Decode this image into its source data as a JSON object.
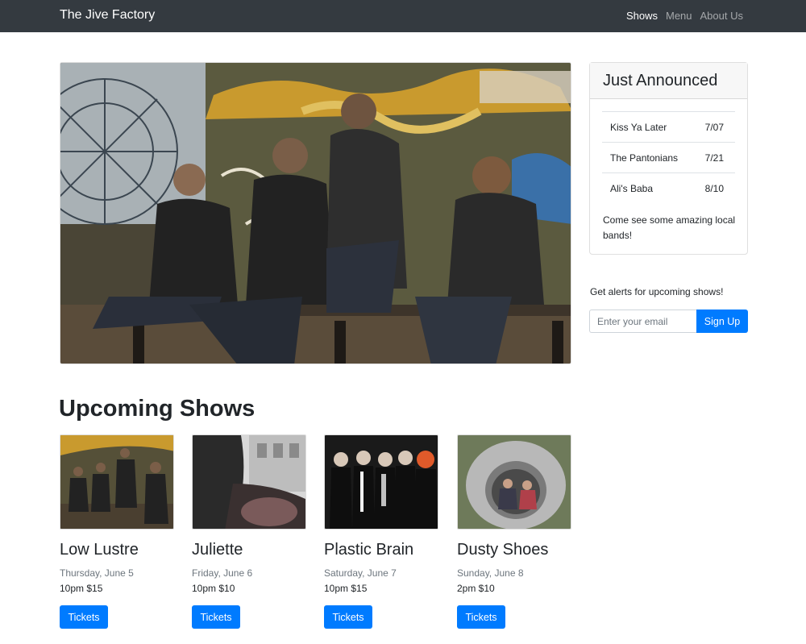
{
  "navbar": {
    "brand": "The Jive Factory",
    "links": [
      {
        "label": "Shows",
        "active": true
      },
      {
        "label": "Menu",
        "active": false
      },
      {
        "label": "About Us",
        "active": false
      }
    ]
  },
  "hero": {
    "image": "band-on-bench-photo"
  },
  "just_announced": {
    "title": "Just Announced",
    "items": [
      {
        "band": "Kiss Ya Later",
        "date": "7/07"
      },
      {
        "band": "The Pantonians",
        "date": "7/21"
      },
      {
        "band": "Ali's Baba",
        "date": "8/10"
      }
    ],
    "text": "Come see some amazing local bands!"
  },
  "alerts": {
    "label": "Get alerts for upcoming shows!",
    "placeholder": "Enter your email",
    "button": "Sign Up"
  },
  "upcoming": {
    "title": "Upcoming Shows",
    "shows": [
      {
        "name": "Low Lustre",
        "date": "Thursday, June 5",
        "time": "10pm $15",
        "button": "Tickets"
      },
      {
        "name": "Juliette",
        "date": "Friday, June 6",
        "time": "10pm $10",
        "button": "Tickets"
      },
      {
        "name": "Plastic Brain",
        "date": "Saturday, June 7",
        "time": "10pm $15",
        "button": "Tickets"
      },
      {
        "name": "Dusty Shoes",
        "date": "Sunday, June 8",
        "time": "2pm $10",
        "button": "Tickets"
      }
    ]
  },
  "colors": {
    "navbar": "#343a40",
    "primary": "#007bff"
  }
}
